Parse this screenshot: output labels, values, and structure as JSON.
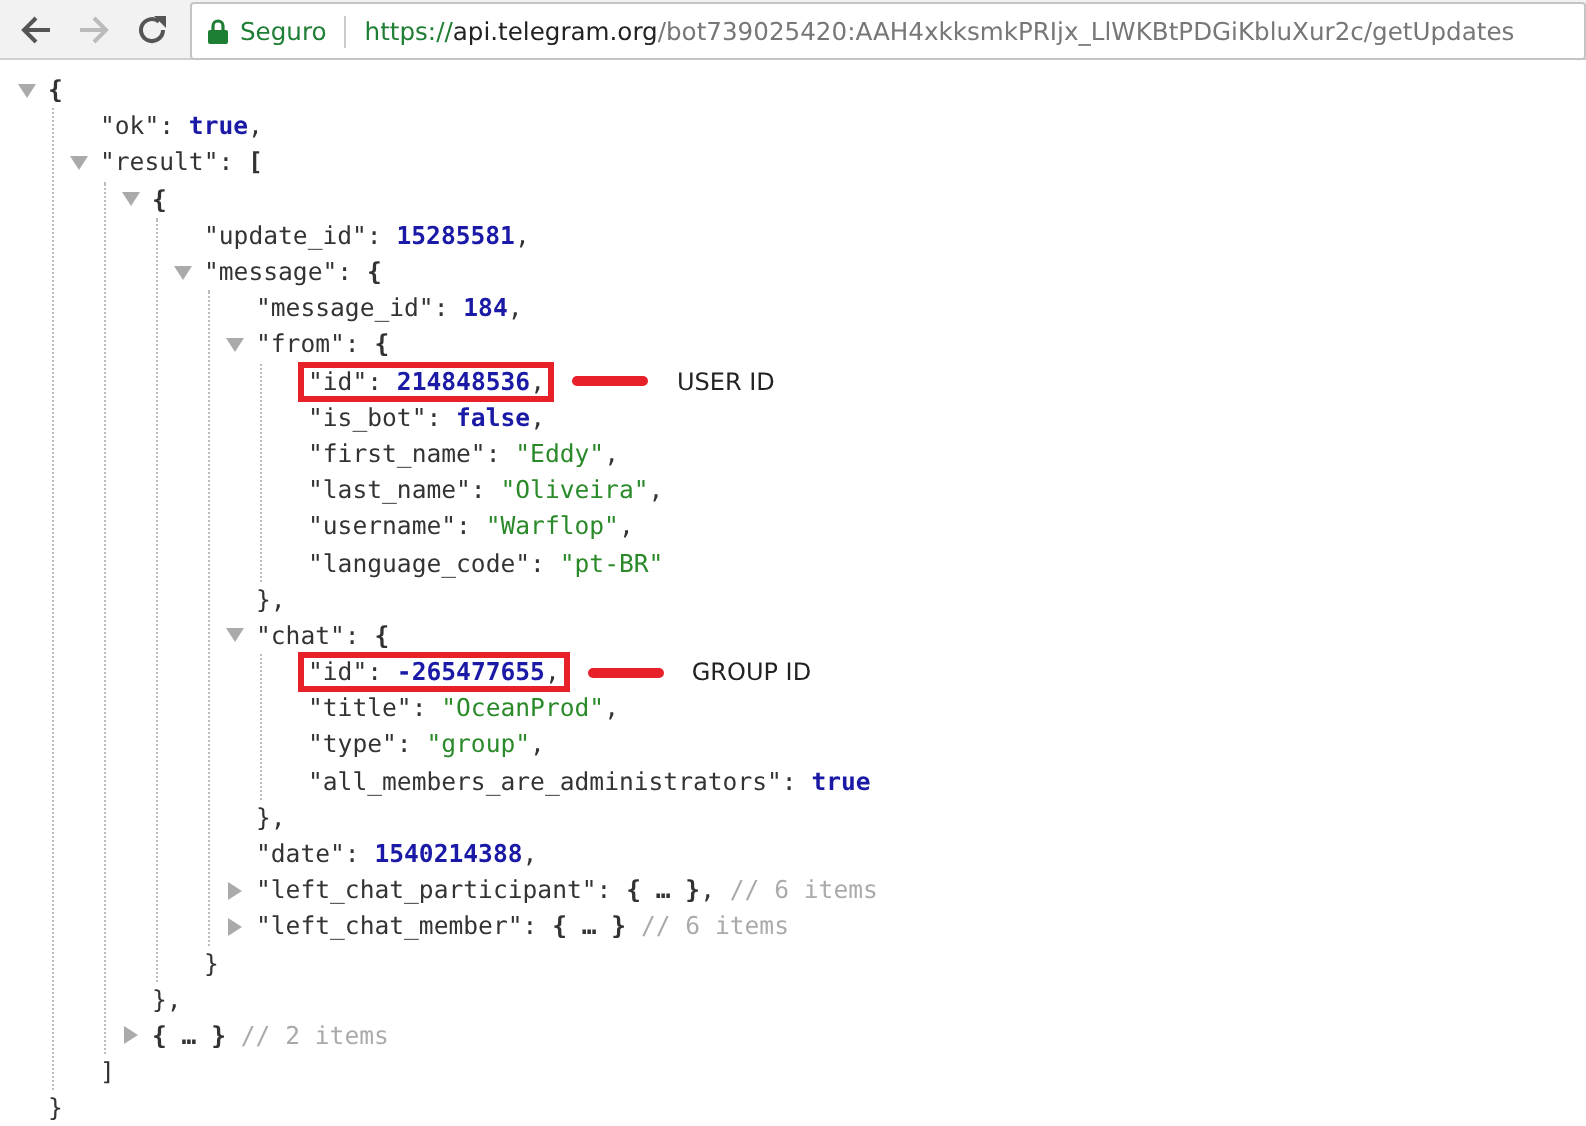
{
  "browser": {
    "back_enabled": true,
    "forward_enabled": false,
    "security_label": "Seguro",
    "url": {
      "scheme": "https://",
      "host": "api.telegram.org",
      "path": "/bot739025420:AAH4xkksmkPRIjx_LlWKBtPDGiKbluXur2c/getUpdates"
    }
  },
  "tree": {
    "kind": "object",
    "open": "{",
    "close": "}",
    "expanded": true,
    "children": [
      {
        "kind": "boolean",
        "key": "\"ok\":",
        "value": "true",
        "comma": ","
      },
      {
        "kind": "array",
        "key": "\"result\":",
        "open": "[",
        "close": "]",
        "expanded": true,
        "children": [
          {
            "kind": "object",
            "open": "{",
            "close": "}",
            "close_comma": ",",
            "expanded": true,
            "children": [
              {
                "kind": "number",
                "key": "\"update_id\":",
                "value": "15285581",
                "comma": ","
              },
              {
                "kind": "object",
                "key": "\"message\":",
                "open": "{",
                "close": "}",
                "expanded": true,
                "children": [
                  {
                    "kind": "number",
                    "key": "\"message_id\":",
                    "value": "184",
                    "comma": ","
                  },
                  {
                    "kind": "object",
                    "key": "\"from\":",
                    "open": "{",
                    "close": "}",
                    "close_comma": ",",
                    "expanded": true,
                    "children": [
                      {
                        "kind": "number",
                        "key": "\"id\":",
                        "value": "214848536",
                        "comma": ",",
                        "highlighted": true,
                        "annotation": "USER ID"
                      },
                      {
                        "kind": "boolean",
                        "key": "\"is_bot\":",
                        "value": "false",
                        "comma": ","
                      },
                      {
                        "kind": "string",
                        "key": "\"first_name\":",
                        "value": "\"Eddy\"",
                        "comma": ","
                      },
                      {
                        "kind": "string",
                        "key": "\"last_name\":",
                        "value": "\"Oliveira\"",
                        "comma": ","
                      },
                      {
                        "kind": "string",
                        "key": "\"username\":",
                        "value": "\"Warflop\"",
                        "comma": ","
                      },
                      {
                        "kind": "string",
                        "key": "\"language_code\":",
                        "value": "\"pt-BR\""
                      }
                    ]
                  },
                  {
                    "kind": "object",
                    "key": "\"chat\":",
                    "open": "{",
                    "close": "}",
                    "close_comma": ",",
                    "expanded": true,
                    "children": [
                      {
                        "kind": "number",
                        "key": "\"id\":",
                        "value": "-265477655",
                        "comma": ",",
                        "highlighted": true,
                        "annotation": "GROUP ID"
                      },
                      {
                        "kind": "string",
                        "key": "\"title\":",
                        "value": "\"OceanProd\"",
                        "comma": ","
                      },
                      {
                        "kind": "string",
                        "key": "\"type\":",
                        "value": "\"group\"",
                        "comma": ","
                      },
                      {
                        "kind": "boolean",
                        "key": "\"all_members_are_administrators\":",
                        "value": "true"
                      }
                    ]
                  },
                  {
                    "kind": "number",
                    "key": "\"date\":",
                    "value": "1540214388",
                    "comma": ","
                  },
                  {
                    "kind": "object",
                    "key": "\"left_chat_participant\":",
                    "open": "{",
                    "ellipsis": "…",
                    "close": "}",
                    "close_comma": ",",
                    "expanded": false,
                    "summary": "// 6 items"
                  },
                  {
                    "kind": "object",
                    "key": "\"left_chat_member\":",
                    "open": "{",
                    "ellipsis": "…",
                    "close": "}",
                    "expanded": false,
                    "summary": "// 6 items"
                  }
                ]
              }
            ]
          },
          {
            "kind": "object",
            "open": "{",
            "ellipsis": "…",
            "close": "}",
            "expanded": false,
            "summary": "// 2 items"
          }
        ]
      }
    ]
  }
}
